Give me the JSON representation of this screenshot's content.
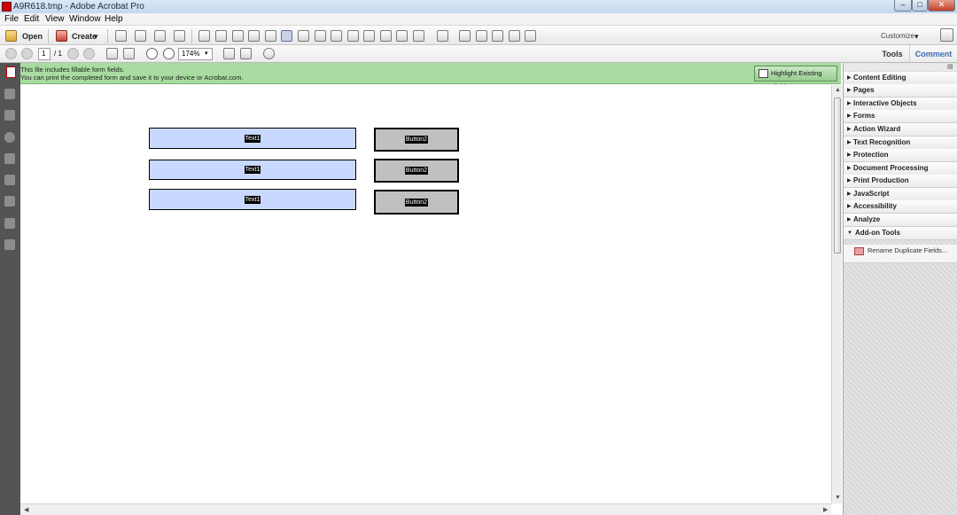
{
  "window": {
    "title": "A9R618.tmp - Adobe Acrobat Pro",
    "min": "–",
    "max": "□",
    "close": "✕"
  },
  "menu": [
    "File",
    "Edit",
    "View",
    "Window",
    "Help"
  ],
  "toolbar": {
    "open_label": "Open",
    "create_label": "Create",
    "customize_label": "Customize"
  },
  "nav": {
    "page_current": "1",
    "page_total": "/ 1",
    "zoom": "174%"
  },
  "tabs": {
    "tools": "Tools",
    "comment": "Comment"
  },
  "message": {
    "line1": "This file includes fillable form fields.",
    "line2": "You can print the completed form and save it to your device or Acrobat.com.",
    "highlight_button": "Highlight Existing Fields"
  },
  "form": {
    "text_fields": [
      "Text1",
      "Text1",
      "Text1"
    ],
    "buttons": [
      "Button2",
      "Button2",
      "Button2"
    ]
  },
  "panel": {
    "items": [
      "Content Editing",
      "Pages",
      "Interactive Objects",
      "Forms",
      "Action Wizard",
      "Text Recognition",
      "Protection",
      "Document Processing",
      "Print Production",
      "JavaScript",
      "Accessibility",
      "Analyze",
      "Add-on Tools"
    ],
    "addon_item": "Rename Duplicate Fields..."
  }
}
